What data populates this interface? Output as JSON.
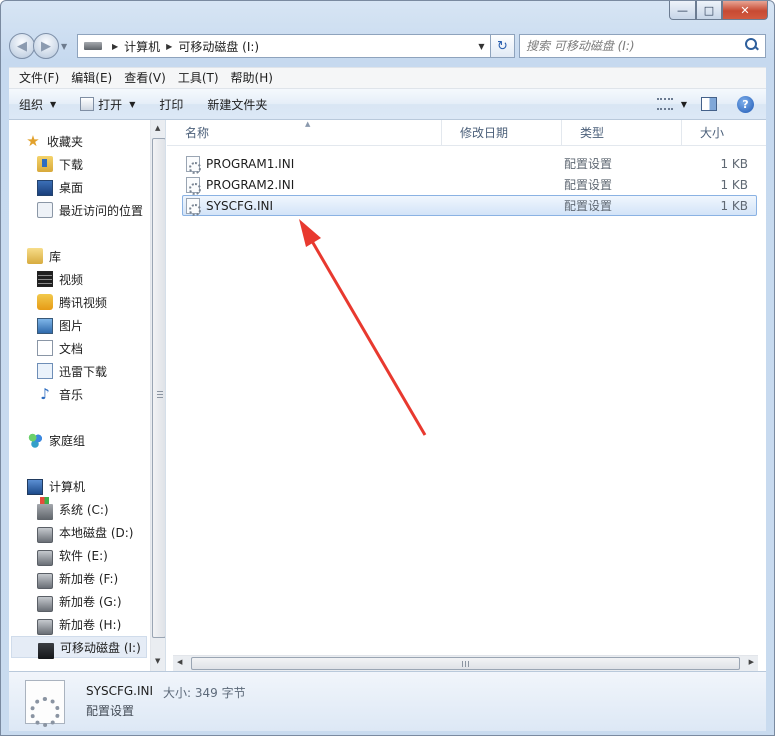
{
  "window": {
    "min": "—",
    "max": "□",
    "close": "✕"
  },
  "address": {
    "crumbs": [
      "计算机",
      "可移动磁盘 (I:)"
    ],
    "search_placeholder": "搜索 可移动磁盘 (I:)"
  },
  "menu": {
    "items": [
      "文件(F)",
      "编辑(E)",
      "查看(V)",
      "工具(T)",
      "帮助(H)"
    ]
  },
  "toolbar": {
    "organize": "组织",
    "open": "打开",
    "print": "打印",
    "new_folder": "新建文件夹",
    "help": "?"
  },
  "sidebar": {
    "items": [
      {
        "label": "收藏夹",
        "icon": "star-icon"
      },
      {
        "label": "下载",
        "icon": "downloads-folder-icon"
      },
      {
        "label": "桌面",
        "icon": "desktop-icon"
      },
      {
        "label": "最近访问的位置",
        "icon": "recent-places-icon"
      },
      {
        "label": "库",
        "icon": "library-icon"
      },
      {
        "label": "视频",
        "icon": "video-library-icon"
      },
      {
        "label": "腾讯视频",
        "icon": "tencent-video-icon"
      },
      {
        "label": "图片",
        "icon": "pictures-icon"
      },
      {
        "label": "文档",
        "icon": "documents-icon"
      },
      {
        "label": "迅雷下载",
        "icon": "thunder-download-icon"
      },
      {
        "label": "音乐",
        "icon": "music-icon"
      },
      {
        "label": "家庭组",
        "icon": "homegroup-icon"
      },
      {
        "label": "计算机",
        "icon": "computer-icon"
      },
      {
        "label": "系统 (C:)",
        "icon": "system-drive-icon"
      },
      {
        "label": "本地磁盘 (D:)",
        "icon": "local-disk-icon"
      },
      {
        "label": "软件 (E:)",
        "icon": "local-disk-icon"
      },
      {
        "label": "新加卷 (F:)",
        "icon": "local-disk-icon"
      },
      {
        "label": "新加卷 (G:)",
        "icon": "local-disk-icon"
      },
      {
        "label": "新加卷 (H:)",
        "icon": "local-disk-icon"
      },
      {
        "label": "可移动磁盘 (I:)",
        "icon": "removable-disk-icon"
      }
    ]
  },
  "columns": {
    "name": "名称",
    "date": "修改日期",
    "type": "类型",
    "size": "大小"
  },
  "files": [
    {
      "name": "PROGRAM1.INI",
      "date": "",
      "type": "配置设置",
      "size": "1 KB"
    },
    {
      "name": "PROGRAM2.INI",
      "date": "",
      "type": "配置设置",
      "size": "1 KB"
    },
    {
      "name": "SYSCFG.INI",
      "date": "",
      "type": "配置设置",
      "size": "1 KB"
    }
  ],
  "details": {
    "name": "SYSCFG.INI",
    "size_label": "大小: 349 字节",
    "type": "配置设置"
  },
  "colors": {
    "annotation_arrow": "#e8392f",
    "selection_border": "#8ab2e3"
  }
}
